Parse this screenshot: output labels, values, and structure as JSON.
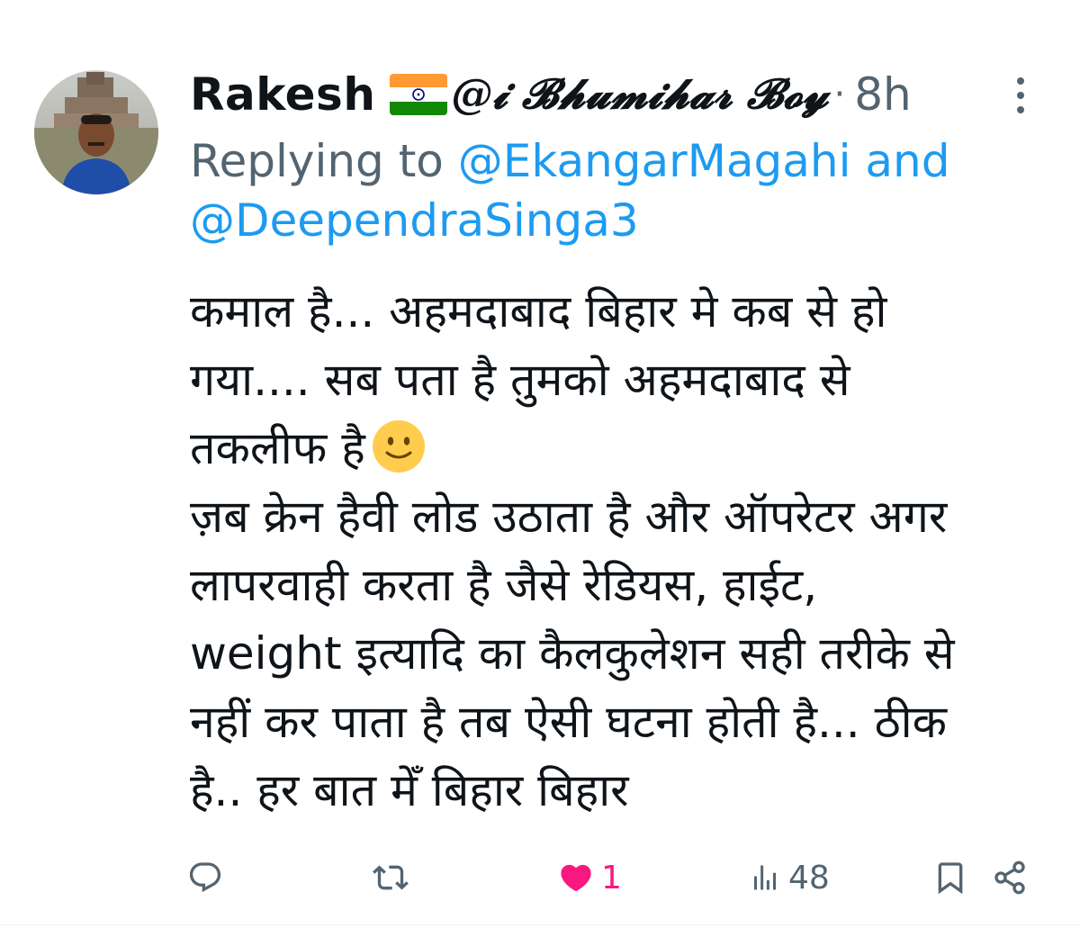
{
  "tweet": {
    "display_name": "Rakesh",
    "handle": "@𝓲 𝓑𝓱𝓾𝓶𝓲𝓱𝓪𝓻 𝓑𝓸𝔂",
    "dot": "·",
    "time": "8h",
    "reply_prefix": "Replying to",
    "reply_user1": "@EkangarMagahi",
    "reply_and": "and",
    "reply_user2": "@DeependraSinga3",
    "body_lines": [
      "कमाल है... अहमदाबाद बिहार मे कब से हो",
      "गया.... सब पता है तुमको अहमदाबाद से",
      "तकलीफ है",
      "ज़ब क्रेन हैवी लोड उठाता है और ऑपरेटर अगर",
      "लापरवाही करता है जैसे रेडियस, हाईट,",
      "weight इत्यादि का कैलकुलेशन सही तरीके से",
      "नहीं कर पाता है तब ऐसी घटना होती है... ठीक",
      "है.. हर बात मेँ बिहार बिहार"
    ],
    "emoji": "slightly-smiling-face",
    "flag": "india-flag"
  },
  "actions": {
    "reply_icon": "reply-icon",
    "retweet_icon": "retweet-icon",
    "like_icon": "heart-filled-icon",
    "like_count": "1",
    "views_icon": "views-chart-icon",
    "views_count": "48",
    "bookmark_icon": "bookmark-icon",
    "share_icon": "share-icon"
  },
  "colors": {
    "text": "#0f1419",
    "secondary": "#536471",
    "link": "#1d9bf0",
    "like": "#f91880"
  }
}
